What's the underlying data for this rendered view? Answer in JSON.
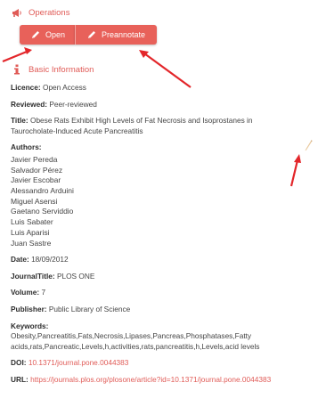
{
  "operations": {
    "title": "Operations",
    "open_label": "Open",
    "preannotate_label": "Preannotate"
  },
  "basic_info": {
    "title": "Basic Information",
    "licence": {
      "label": "Licence:",
      "value": "Open Access"
    },
    "reviewed": {
      "label": "Reviewed:",
      "value": "Peer-reviewed"
    },
    "title_field": {
      "label": "Title:",
      "value": "Obese Rats Exhibit High Levels of Fat Necrosis and Isoprostanes in Taurocholate-Induced Acute Pancreatitis"
    },
    "authors_label": "Authors:",
    "authors": [
      "Javier Pereda",
      "Salvador Pérez",
      "Javier Escobar",
      "Alessandro Arduini",
      "Miguel Asensi",
      "Gaetano Serviddio",
      "Luis Sabater",
      "Luis Aparisi",
      "Juan Sastre"
    ],
    "date": {
      "label": "Date:",
      "value": "18/09/2012"
    },
    "journal": {
      "label": "JournalTitle:",
      "value": "PLOS ONE"
    },
    "volume": {
      "label": "Volume:",
      "value": "7"
    },
    "publisher": {
      "label": "Publisher:",
      "value": "Public Library of Science"
    },
    "keywords": {
      "label": "Keywords:",
      "value": "Obesity,Pancreatitis,Fats,Necrosis,Lipases,Pancreas,Phosphatases,Fatty acids,rats,Pancreatic,Levels,h,activities,rats,pancreatitis,h,Levels,acid levels"
    },
    "doi": {
      "label": "DOI:",
      "value": "10.1371/journal.pone.0044383"
    },
    "url": {
      "label": "URL:",
      "value": "https://journals.plos.org/plosone/article?id=10.1371/journal.pone.0044383"
    }
  },
  "colors": {
    "accent": "#e05b57",
    "button": "#e8615a",
    "arrow": "#e3262a"
  },
  "icons": {
    "operations": "megaphone-icon",
    "info": "info-icon",
    "pen": "pencil-icon"
  }
}
